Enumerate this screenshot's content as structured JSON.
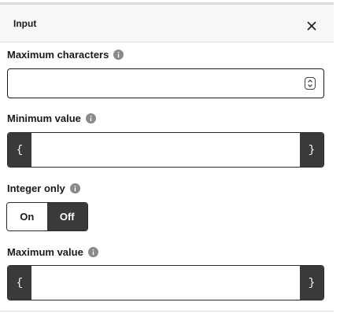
{
  "panel": {
    "title": "Input",
    "close_icon": "close-icon"
  },
  "fields": {
    "max_chars": {
      "label": "Maximum characters",
      "value": ""
    },
    "min_value": {
      "label": "Minimum value",
      "open": "{",
      "close": "}",
      "value": ""
    },
    "integer_only": {
      "label": "Integer only",
      "on_label": "On",
      "off_label": "Off",
      "selected": "Off"
    },
    "max_value": {
      "label": "Maximum value",
      "open": "{",
      "close": "}",
      "value": ""
    }
  },
  "colors": {
    "dark": "#3a3a3a",
    "info_icon": "#8a8a8a",
    "header_bg": "#f7f7f7"
  }
}
